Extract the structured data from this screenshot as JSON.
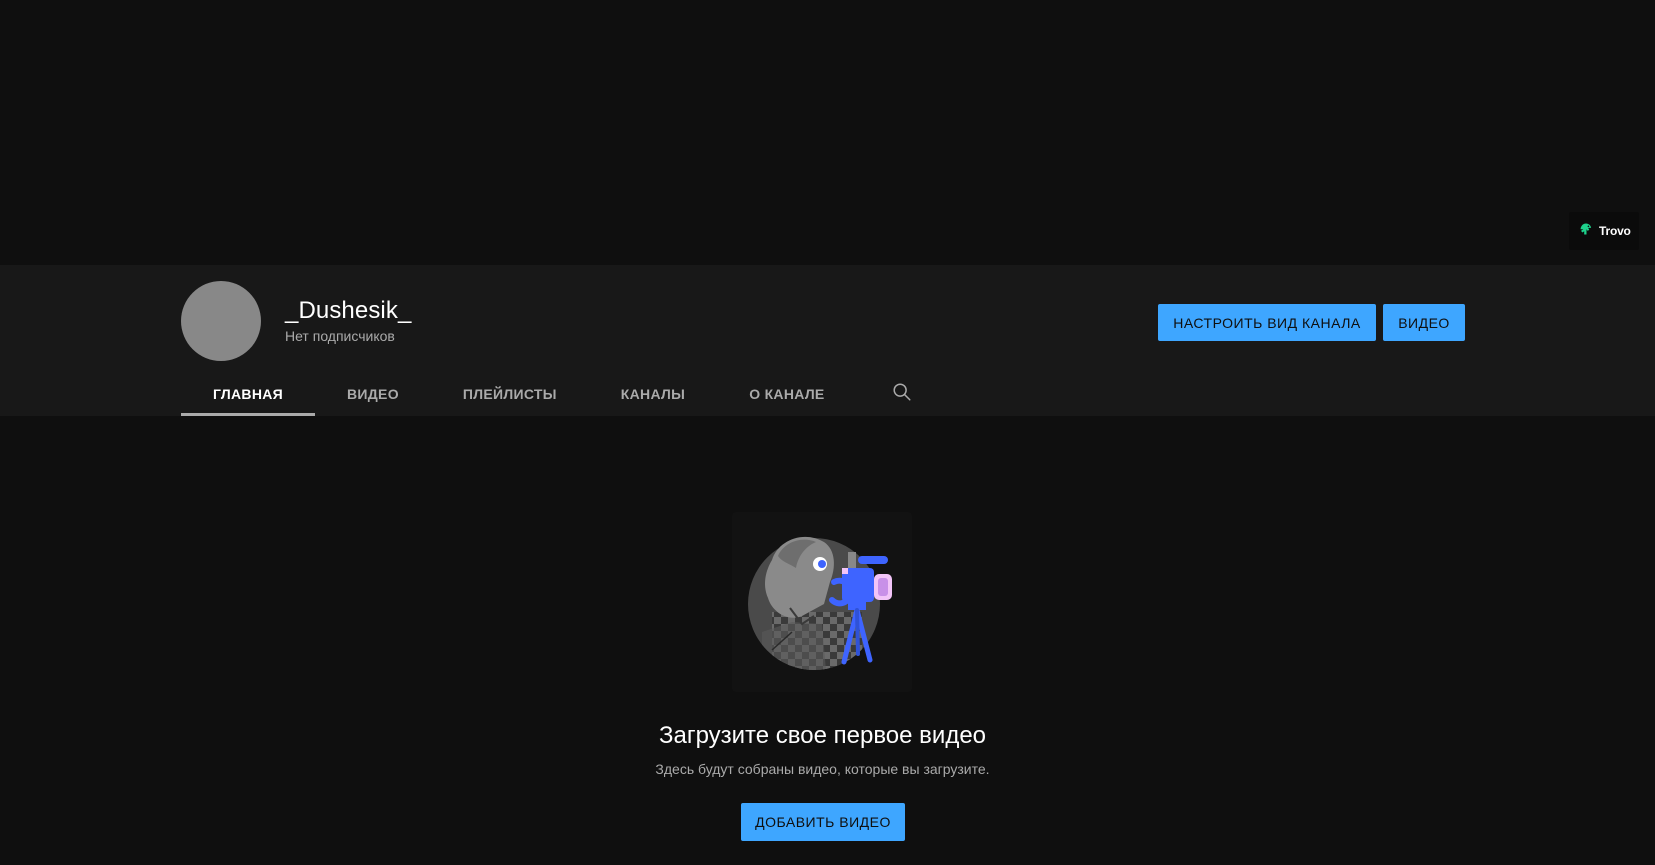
{
  "banner": {
    "link_label": "Trovo",
    "link_icon": "trovo-icon"
  },
  "channel": {
    "name": "_Dushesik_",
    "subscribers": "Нет подписчиков",
    "buttons": {
      "customize": "Настроить вид канала",
      "videos": "Видео"
    }
  },
  "tabs": [
    {
      "label": "Главная",
      "active": true
    },
    {
      "label": "Видео",
      "active": false
    },
    {
      "label": "Плейлисты",
      "active": false
    },
    {
      "label": "Каналы",
      "active": false
    },
    {
      "label": "О канале",
      "active": false
    }
  ],
  "search_icon": "search-icon",
  "empty_state": {
    "illustration": "camera-operator-illustration",
    "title": "Загрузите свое первое видео",
    "subtitle": "Здесь будут собраны видео, которые вы загрузите.",
    "button": "Добавить видео"
  },
  "colors": {
    "background": "#0f0f0f",
    "header_background": "#181818",
    "accent": "#3ea6ff",
    "text_secondary": "#aaaaaa",
    "avatar": "#888888",
    "trovo_green": "#1ed28c"
  }
}
